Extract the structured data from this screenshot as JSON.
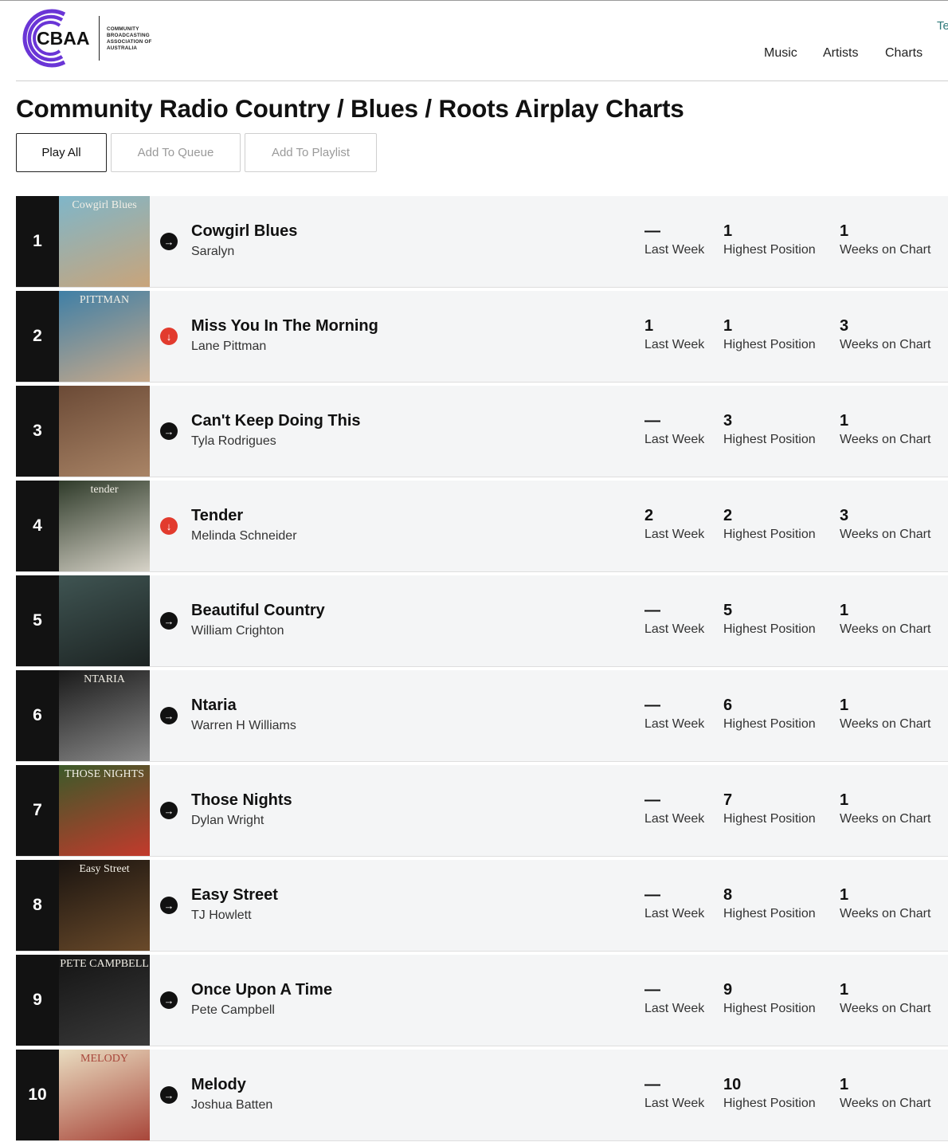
{
  "header": {
    "logo_text": "CBAA",
    "logo_subtitle": "COMMUNITY BROADCASTING ASSOCIATION OF AUSTRALIA",
    "top_right_partial": "Te",
    "nav": [
      "Music",
      "Artists",
      "Charts"
    ]
  },
  "page_title": "Community Radio Country / Blues / Roots Airplay Charts",
  "actions": {
    "play_all": "Play All",
    "add_to_queue": "Add To Queue",
    "add_to_playlist": "Add To Playlist"
  },
  "labels": {
    "last_week": "Last Week",
    "highest_position": "Highest Position",
    "weeks_on_chart": "Weeks on Chart"
  },
  "chart": [
    {
      "rank": "1",
      "title": "Cowgirl Blues",
      "artist": "Saralyn",
      "movement": "same",
      "last_week": "—",
      "highest": "1",
      "weeks": "1",
      "art_text": "Cowgirl Blues",
      "art_colors": [
        "#7fb6c9",
        "#c9a47a"
      ]
    },
    {
      "rank": "2",
      "title": "Miss You In The Morning",
      "artist": "Lane Pittman",
      "movement": "down",
      "last_week": "1",
      "highest": "1",
      "weeks": "3",
      "art_text": "PITTMAN",
      "art_colors": [
        "#3f7fa6",
        "#c8a98a"
      ]
    },
    {
      "rank": "3",
      "title": "Can't Keep Doing This",
      "artist": "Tyla Rodrigues",
      "movement": "same",
      "last_week": "—",
      "highest": "3",
      "weeks": "1",
      "art_text": "",
      "art_colors": [
        "#6b4a36",
        "#a98466"
      ]
    },
    {
      "rank": "4",
      "title": "Tender",
      "artist": "Melinda Schneider",
      "movement": "down",
      "last_week": "2",
      "highest": "2",
      "weeks": "3",
      "art_text": "tender",
      "art_colors": [
        "#2f3b2a",
        "#d7d3c8"
      ]
    },
    {
      "rank": "5",
      "title": "Beautiful Country",
      "artist": "William Crighton",
      "movement": "same",
      "last_week": "—",
      "highest": "5",
      "weeks": "1",
      "art_text": "",
      "art_colors": [
        "#3f5452",
        "#1c2322"
      ]
    },
    {
      "rank": "6",
      "title": "Ntaria",
      "artist": "Warren H Williams",
      "movement": "same",
      "last_week": "—",
      "highest": "6",
      "weeks": "1",
      "art_text": "NTARIA",
      "art_colors": [
        "#1a1a1a",
        "#8a8a8a"
      ]
    },
    {
      "rank": "7",
      "title": "Those Nights",
      "artist": "Dylan Wright",
      "movement": "same",
      "last_week": "—",
      "highest": "7",
      "weeks": "1",
      "art_text": "THOSE NIGHTS",
      "art_colors": [
        "#3b5a2a",
        "#c33a2c"
      ]
    },
    {
      "rank": "8",
      "title": "Easy Street",
      "artist": "TJ Howlett",
      "movement": "same",
      "last_week": "—",
      "highest": "8",
      "weeks": "1",
      "art_text": "Easy Street",
      "art_colors": [
        "#1a1410",
        "#6a4a2a"
      ]
    },
    {
      "rank": "9",
      "title": "Once Upon A Time",
      "artist": "Pete Campbell",
      "movement": "same",
      "last_week": "—",
      "highest": "9",
      "weeks": "1",
      "art_text": "PETE CAMPBELL",
      "art_colors": [
        "#141414",
        "#3a3a3a"
      ]
    },
    {
      "rank": "10",
      "title": "Melody",
      "artist": "Joshua Batten",
      "movement": "same",
      "last_week": "—",
      "highest": "10",
      "weeks": "1",
      "art_text": "MELODY",
      "art_colors": [
        "#e9dcc0",
        "#a8463a"
      ]
    }
  ]
}
